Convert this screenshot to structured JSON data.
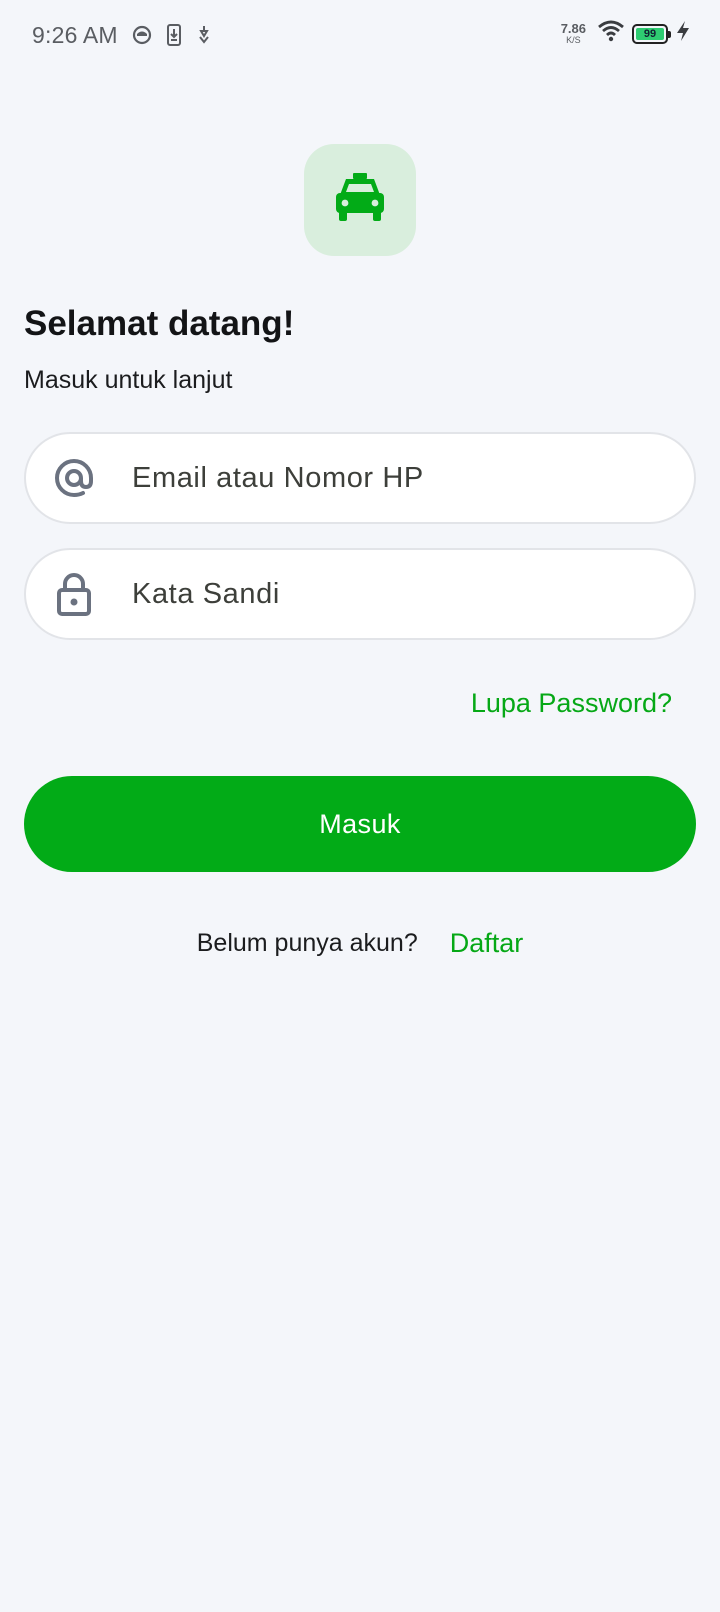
{
  "status_bar": {
    "time": "9:26 AM",
    "net_speed_value": "7.86",
    "net_speed_unit": "K/S",
    "battery_level": "99",
    "icons": [
      "app-notification-icon",
      "download-phone-icon",
      "usb-debug-icon",
      "wifi-icon",
      "battery-icon",
      "charging-bolt-icon"
    ]
  },
  "logo": {
    "icon": "taxi-icon",
    "accent_color": "#02ab17",
    "background_color": "#d9eedd"
  },
  "header": {
    "title": "Selamat datang!",
    "subtitle": "Masuk untuk lanjut"
  },
  "form": {
    "email": {
      "icon": "at-sign-icon",
      "placeholder": "Email atau Nomor HP",
      "value": ""
    },
    "password": {
      "icon": "lock-icon",
      "placeholder": "Kata Sandi",
      "value": ""
    },
    "forgot_label": "Lupa Password?",
    "submit_label": "Masuk"
  },
  "register": {
    "prompt": "Belum punya akun?",
    "link_label": "Daftar"
  }
}
